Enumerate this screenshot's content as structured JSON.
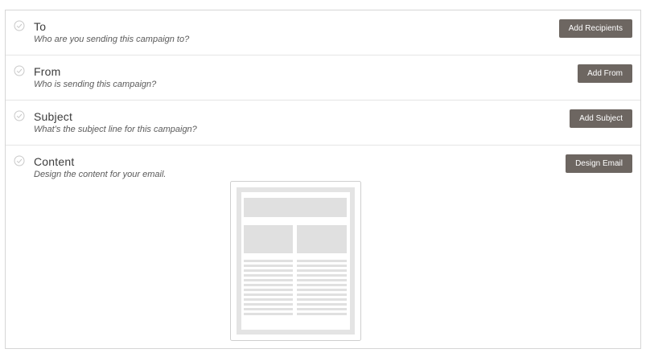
{
  "rows": [
    {
      "title": "To",
      "subtitle": "Who are you sending this campaign to?",
      "button": "Add Recipients"
    },
    {
      "title": "From",
      "subtitle": "Who is sending this campaign?",
      "button": "Add From"
    },
    {
      "title": "Subject",
      "subtitle": "What’s the subject line for this campaign?",
      "button": "Add Subject"
    },
    {
      "title": "Content",
      "subtitle": "Design the content for your email.",
      "button": "Design Email"
    }
  ],
  "colors": {
    "button_bg": "#6d6661",
    "check": "#c9c9c9",
    "placeholder": "#e0e0e0"
  },
  "icons": {
    "status": "check-circle-icon"
  }
}
